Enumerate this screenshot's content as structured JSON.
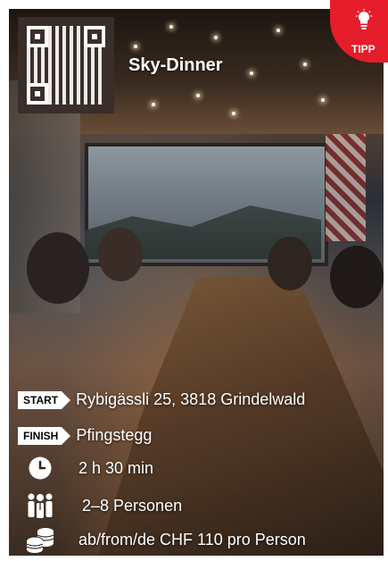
{
  "header": {
    "title": "Sky-Dinner",
    "badge_label": "TIPP"
  },
  "details": {
    "start_label": "START",
    "start_value": "Rybigässli 25, 3818 Grindelwald",
    "finish_label": "FINISH",
    "finish_value": "Pfingstegg",
    "duration": "2 h 30 min",
    "persons": "2–8 Personen",
    "price": "ab/from/de CHF 110 pro Person"
  },
  "icons": {
    "tipp": "lightbulb-icon",
    "duration": "clock-icon",
    "persons": "group-icon",
    "price": "coins-icon",
    "qr": "qr-code"
  },
  "colors": {
    "accent": "#e51d2a",
    "text": "#ffffff"
  }
}
